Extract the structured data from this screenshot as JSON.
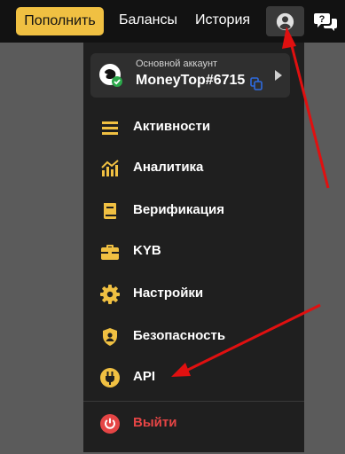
{
  "topbar": {
    "topup_label": "Пополнить",
    "balances_label": "Балансы",
    "history_label": "История"
  },
  "account": {
    "caption": "Основной аккаунт",
    "name": "MoneyTop#6715"
  },
  "menu": {
    "items": [
      {
        "label": "Активности",
        "icon": "activity-list-icon"
      },
      {
        "label": "Аналитика",
        "icon": "analytics-chart-icon"
      },
      {
        "label": "Верификация",
        "icon": "verification-book-icon"
      },
      {
        "label": "KYB",
        "icon": "briefcase-icon"
      },
      {
        "label": "Настройки",
        "icon": "gear-icon"
      },
      {
        "label": "Безопасность",
        "icon": "shield-user-icon"
      },
      {
        "label": "API",
        "icon": "plug-icon"
      }
    ],
    "logout_label": "Выйти"
  },
  "colors": {
    "accent": "#f0c042",
    "topbar_bg": "#121212",
    "menu_bg": "#1f1f1f",
    "logout": "#e54545",
    "annotation_arrow": "#e01010"
  }
}
